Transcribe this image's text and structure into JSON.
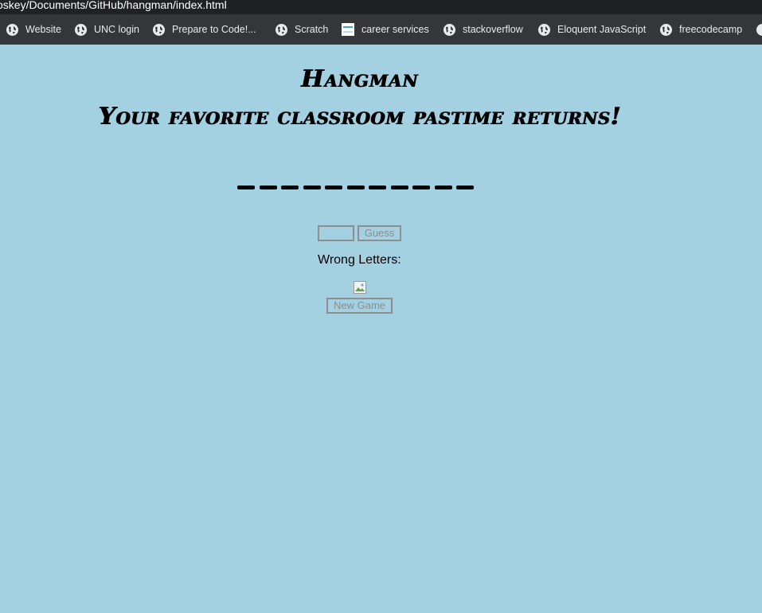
{
  "browser": {
    "url": "/Users/foskey/Documents/GitHub/hangman/index.html",
    "url_visible": "oskey/Documents/GitHub/hangman/index.html",
    "bookmarks": [
      {
        "label": "Website",
        "icon": "globe-icon"
      },
      {
        "label": "UNC login",
        "icon": "globe-icon"
      },
      {
        "label": "Prepare to Code!...",
        "icon": "globe-icon"
      },
      {
        "label": "Scratch",
        "icon": "globe-icon"
      },
      {
        "label": "career services",
        "icon": "career-services-favicon"
      },
      {
        "label": "stackoverflow",
        "icon": "globe-icon"
      },
      {
        "label": "Eloquent JavaScript",
        "icon": "globe-icon"
      },
      {
        "label": "freecodecamp",
        "icon": "globe-icon"
      }
    ]
  },
  "page": {
    "title": "Hangman",
    "subtitle": "Your favorite classroom pastime returns!",
    "blank_count": 11,
    "guess_input": {
      "value": "",
      "placeholder": ""
    },
    "guess_button": "Guess",
    "wrong_letters_label": "Wrong Letters:",
    "wrong_letters": "",
    "hangman_image": "broken-image-icon",
    "new_game_button": "New Game"
  },
  "colors": {
    "page_background": "#a3d1e1",
    "chrome_background": "#35363a",
    "button_border": "#8e8e8e"
  }
}
